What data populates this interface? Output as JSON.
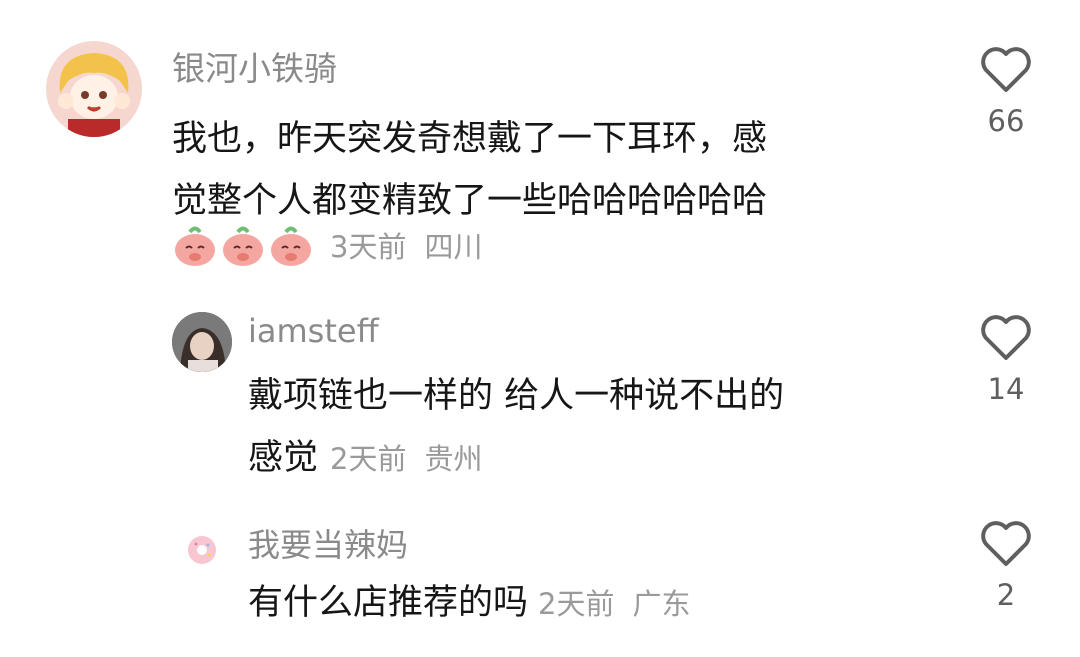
{
  "comments": [
    {
      "username": "银河小铁骑",
      "text": "我也，昨天突发奇想戴了一下耳环，感觉整个人都变精致了一些哈哈哈哈哈哈",
      "line1": "我也，昨天突发奇想戴了一下耳环，感",
      "line2": "觉整个人都变精致了一些哈哈哈哈哈哈",
      "time": "3天前",
      "location": "四川",
      "likes": "66",
      "emoji_count": 3
    },
    {
      "username": "iamsteff",
      "line1": "戴项链也一样的  给人一种说不出的",
      "line2": "感觉",
      "time": "2天前",
      "location": "贵州",
      "likes": "14"
    },
    {
      "username": "我要当辣妈",
      "line1": "有什么店推荐的吗",
      "time": "2天前",
      "location": "广东",
      "likes": "2"
    }
  ],
  "icons": {
    "like": "heart-outline-icon",
    "emoji": "peach-bun-sticker"
  },
  "colors": {
    "text": "#161616",
    "username": "#8a8a8a",
    "meta": "#9a9a9a",
    "heart": "#5f5f5f"
  }
}
